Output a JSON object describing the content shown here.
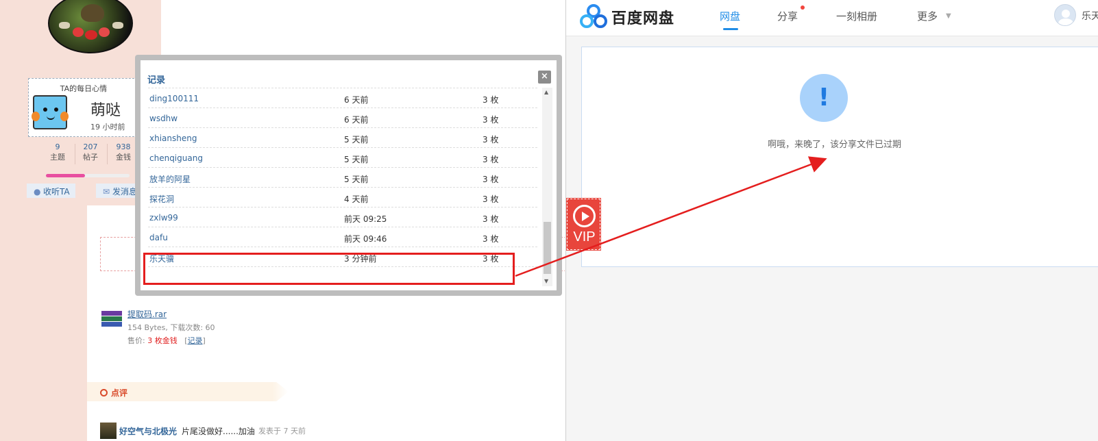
{
  "forum": {
    "mood": {
      "title": "TA的每日心情",
      "text": "萌哒",
      "time": "19 小时前"
    },
    "stats": [
      {
        "value": "9",
        "label": "主题"
      },
      {
        "value": "207",
        "label": "帖子"
      },
      {
        "value": "938",
        "label": "金钱"
      }
    ],
    "level_progress": 0.47,
    "buttons": {
      "follow": "收听TA",
      "message": "发消息"
    },
    "attachment": {
      "name": "提取码.rar",
      "meta": "154 Bytes, 下载次数: 60",
      "price_label": "售价:",
      "price_value": "3 枚金钱",
      "record_link": "记录"
    },
    "review": {
      "label": "点评"
    },
    "comment": {
      "user": "好空气与北极光",
      "text": "片尾没做好......加油",
      "time": "发表于 7 天前"
    }
  },
  "dialog": {
    "title": "记录",
    "close": "×",
    "records": [
      {
        "user": "ding100111",
        "time": "6 天前",
        "amount": "3 枚"
      },
      {
        "user": "wsdhw",
        "time": "6 天前",
        "amount": "3 枚"
      },
      {
        "user": "xhiansheng",
        "time": "5 天前",
        "amount": "3 枚"
      },
      {
        "user": "chenqiguang",
        "time": "5 天前",
        "amount": "3 枚"
      },
      {
        "user": "放羊的阿星",
        "time": "5 天前",
        "amount": "3 枚"
      },
      {
        "user": "探花洞",
        "time": "4 天前",
        "amount": "3 枚"
      },
      {
        "user": "zxlw99",
        "time": "前天 09:25",
        "amount": "3 枚"
      },
      {
        "user": "dafu",
        "time": "前天 09:46",
        "amount": "3 枚"
      },
      {
        "user": "乐天骥",
        "time": "3 分钟前",
        "amount": "3 枚"
      }
    ]
  },
  "baidu": {
    "logo_text": "百度网盘",
    "nav": {
      "netdisk": "网盘",
      "share": "分享",
      "album": "一刻相册",
      "more": "更多"
    },
    "user_name": "乐天",
    "expired_message": "啊哦，来晚了，该分享文件已过期",
    "accent_color": "#1f8ce6"
  },
  "vip_badge": {
    "label": "VIP"
  },
  "annotation": {
    "highlight_color": "#e41e1e"
  }
}
